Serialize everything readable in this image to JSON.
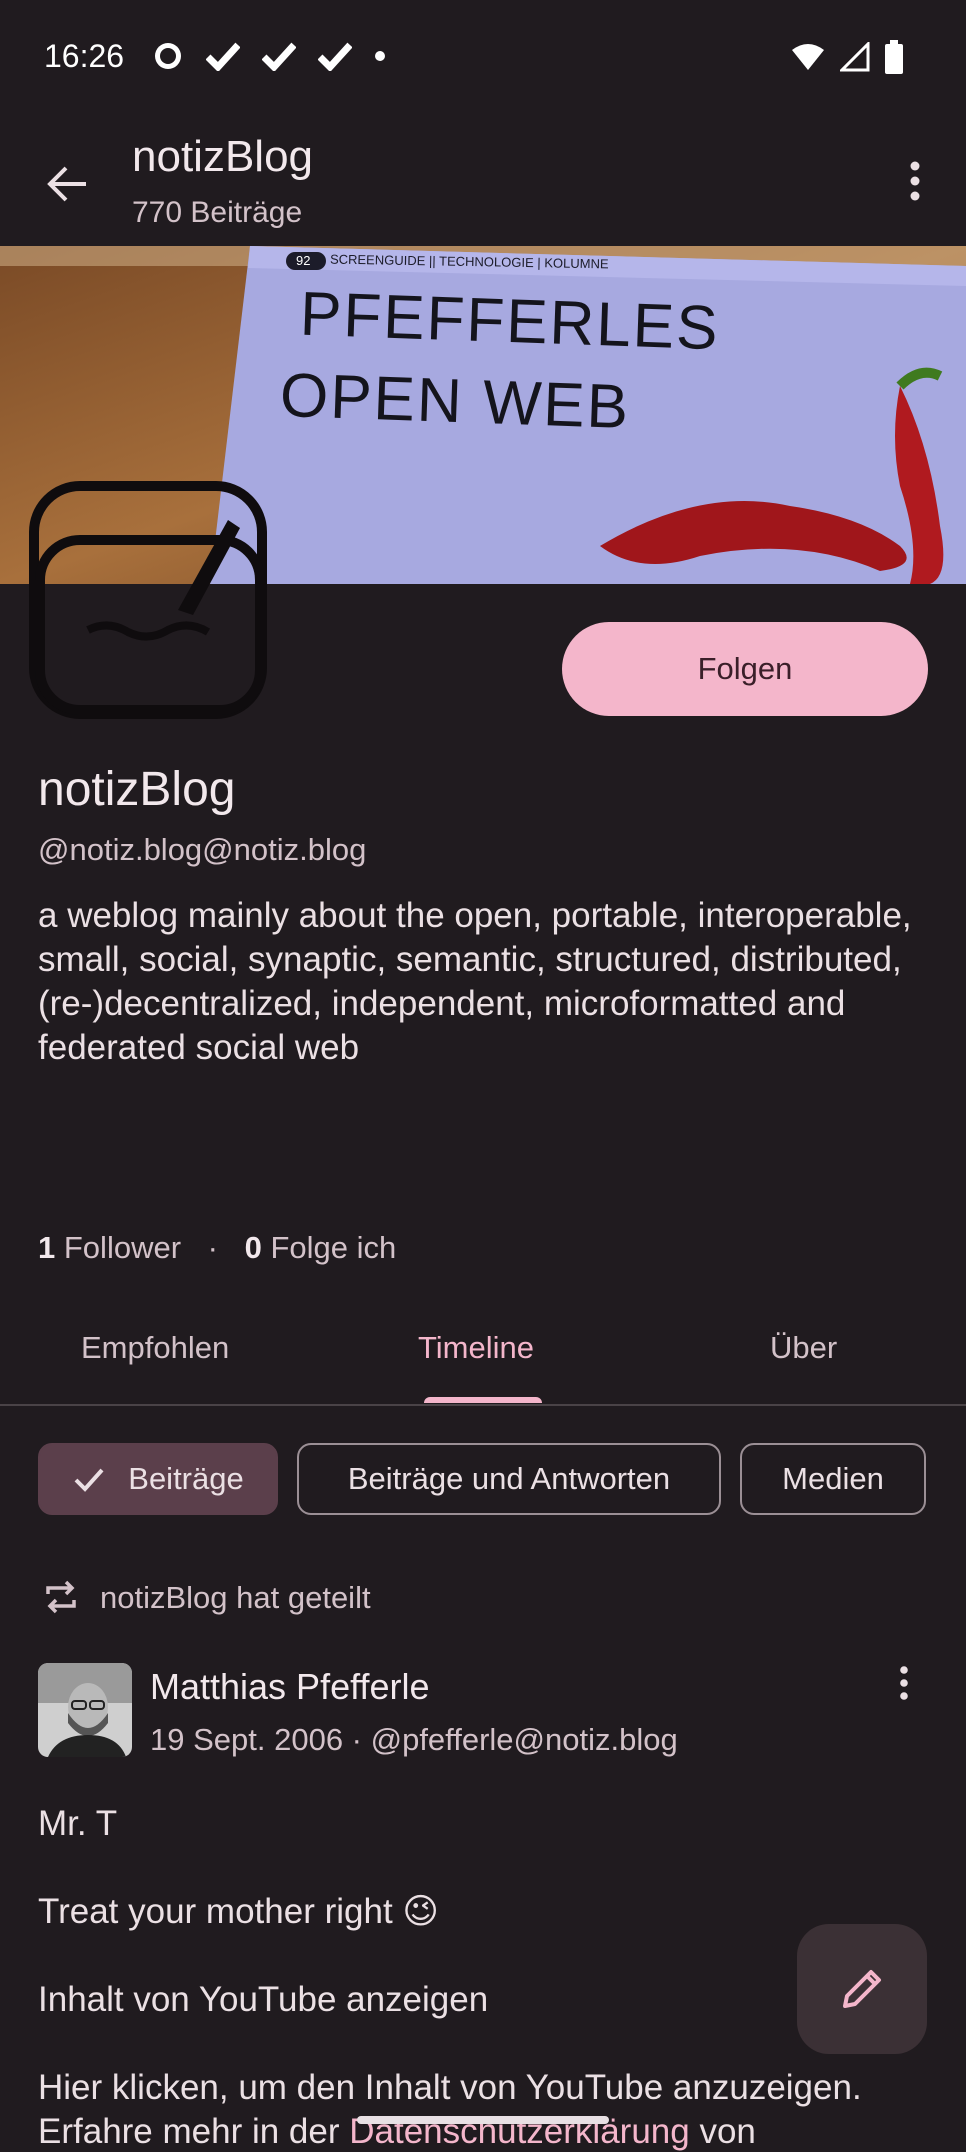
{
  "status_bar": {
    "time": "16:26"
  },
  "app_bar": {
    "title": "notizBlog",
    "subtitle": "770 Beiträge"
  },
  "banner": {
    "magazine_header": "SCREENGUIDE || TECHNOLOGIE | KOLUMNE",
    "page_number": "92",
    "headline_line1": "PFEFFERLES",
    "headline_line2": "OPEN WEB"
  },
  "profile": {
    "follow_label": "Folgen",
    "name": "notizBlog",
    "handle": "@notiz.blog@notiz.blog",
    "bio": "a weblog mainly about the open, portable, interoperable, small, social, synaptic, semantic, structured, distributed, (re-)decentralized, independent, microformatted and federated social web",
    "followers_count": "1",
    "followers_label": "Follower",
    "following_count": "0",
    "following_label": "Folge ich",
    "separator": "·"
  },
  "tabs": [
    {
      "label": "Empfohlen"
    },
    {
      "label": "Timeline"
    },
    {
      "label": "Über"
    }
  ],
  "filters": [
    {
      "label": "Beiträge"
    },
    {
      "label": "Beiträge und Antworten"
    },
    {
      "label": "Medien"
    }
  ],
  "post": {
    "boost_text": "notizBlog hat geteilt",
    "author": "Matthias Pfefferle",
    "meta": "19 Sept. 2006 · @pfefferle@notiz.blog",
    "line1": "Mr. T",
    "line2": "Treat your mother right 😉",
    "line3": " Inhalt von YouTube anzeigen",
    "line4": " Hier klicken, um den Inhalt von YouTube anzuzeigen.",
    "line5_prefix": "Erfahre mehr in der ",
    "line5_link": "Datenschutzerklärung",
    "line5_suffix": " von"
  },
  "colors": {
    "background": "#201b1f",
    "accent": "#f4b6cb",
    "chip_selected": "#5b3f4b"
  }
}
